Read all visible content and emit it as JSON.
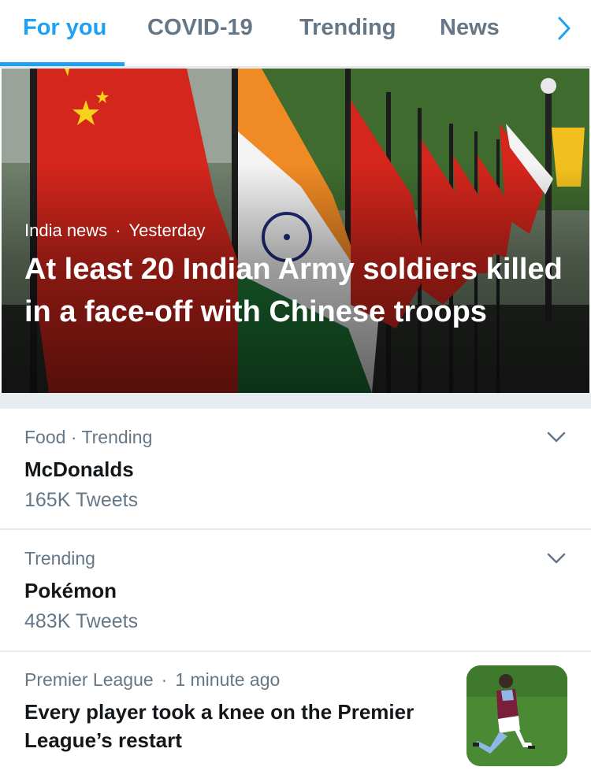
{
  "tabs": [
    {
      "label": "For you"
    },
    {
      "label": "COVID-19"
    },
    {
      "label": "Trending"
    },
    {
      "label": "News"
    }
  ],
  "accent_color": "#1da1f2",
  "hero": {
    "category": "India news",
    "separator": "·",
    "time": "Yesterday",
    "title": "At least 20 Indian Army soldiers killed in a face-off with Chinese troops"
  },
  "trends": [
    {
      "meta": "Food · Trending",
      "title": "McDonalds",
      "count": "165K Tweets"
    },
    {
      "meta": "Trending",
      "title": "Pokémon",
      "count": "483K Tweets"
    }
  ],
  "story": {
    "category": "Premier League",
    "separator": "·",
    "time": "1 minute ago",
    "title": "Every player took a knee on the Premier League’s restart"
  }
}
